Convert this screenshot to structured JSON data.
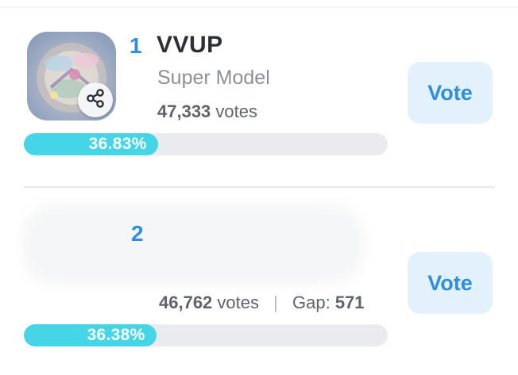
{
  "entries": [
    {
      "rank": "1",
      "name": "VVUP",
      "subtitle": "Super Model",
      "votes_num": "47,333",
      "votes_word": "votes",
      "percent_label": "36.83%",
      "percent": 36.83,
      "vote_label": "Vote",
      "avatar_icon": "share-icon"
    },
    {
      "rank": "2",
      "votes_num": "46,762",
      "votes_word": "votes",
      "separator": "|",
      "gap_label": "Gap:",
      "gap_value": "571",
      "percent_label": "36.38%",
      "percent": 36.38,
      "vote_label": "Vote"
    }
  ],
  "colors": {
    "accent": "#2c8fe0",
    "progress_fill": "#45d5e7",
    "progress_track": "#e9ebef",
    "vote_button_bg": "#e3f1fc"
  }
}
